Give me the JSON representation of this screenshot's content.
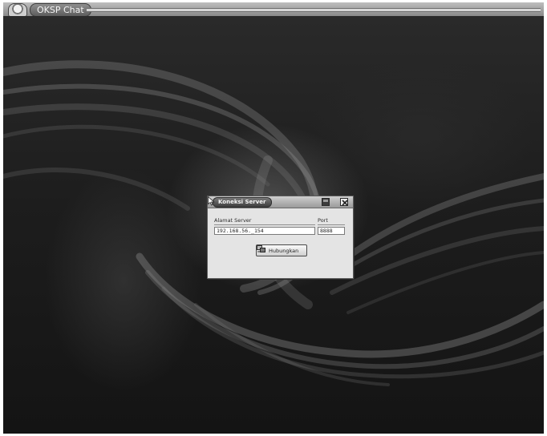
{
  "app": {
    "title": "OKSP Chat",
    "icon": "app-logo-icon"
  },
  "dialog": {
    "title": "Koneksi Server",
    "minimize_icon": "minimize-icon",
    "close_icon": "close-icon",
    "address_label": "Alamat Server",
    "address_value": "192.168.56._154",
    "port_label": "Port",
    "port_value": "8888",
    "connect_label": "Hubungkan",
    "connect_icon": "network-icon"
  },
  "colors": {
    "desktop_background": "#1d1d1d",
    "dialog_background": "#e4e4e4",
    "titlebar": "#9a9a9a"
  }
}
